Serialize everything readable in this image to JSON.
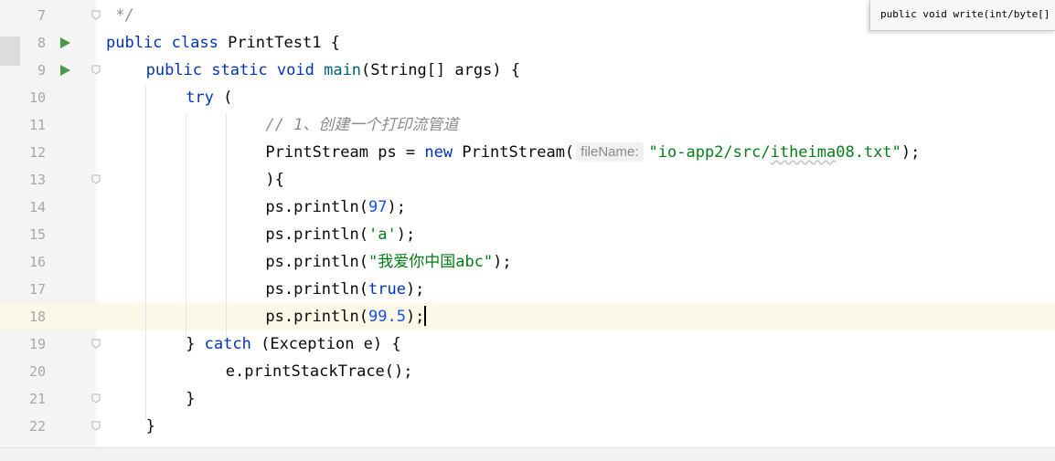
{
  "editor": {
    "lines": [
      {
        "num": "7",
        "indent": 0,
        "run_icon": false,
        "fold_icon": true,
        "current": false,
        "tokens": [
          {
            "t": " */",
            "c": "cmt"
          }
        ]
      },
      {
        "num": "8",
        "indent": 0,
        "run_icon": true,
        "fold_icon": false,
        "current": false,
        "tokens": [
          {
            "t": "public ",
            "c": "kw"
          },
          {
            "t": "class ",
            "c": "kw"
          },
          {
            "t": "PrintTest1 {",
            "c": ""
          }
        ]
      },
      {
        "num": "9",
        "indent": 1,
        "run_icon": true,
        "fold_icon": true,
        "current": false,
        "tokens": [
          {
            "t": "public ",
            "c": "kw"
          },
          {
            "t": "static ",
            "c": "kw"
          },
          {
            "t": "void ",
            "c": "kw"
          },
          {
            "t": "main",
            "c": "fn"
          },
          {
            "t": "(String[] args) {",
            "c": ""
          }
        ]
      },
      {
        "num": "10",
        "indent": 2,
        "run_icon": false,
        "fold_icon": false,
        "current": false,
        "tokens": [
          {
            "t": "try ",
            "c": "kw"
          },
          {
            "t": "(",
            "c": ""
          }
        ]
      },
      {
        "num": "11",
        "indent": 4,
        "run_icon": false,
        "fold_icon": false,
        "current": false,
        "tokens": [
          {
            "t": "// 1、创建一个打印流管道",
            "c": "cmt"
          }
        ]
      },
      {
        "num": "12",
        "indent": 4,
        "run_icon": false,
        "fold_icon": false,
        "current": false,
        "tokens": [
          {
            "t": "PrintStream ps = ",
            "c": ""
          },
          {
            "t": "new ",
            "c": "kw"
          },
          {
            "t": "PrintStream(",
            "c": ""
          },
          {
            "t": "fileName:",
            "c": "hint"
          },
          {
            "t": "\"io-app2/src/",
            "c": "str"
          },
          {
            "t": "itheima",
            "c": "str squiggle"
          },
          {
            "t": "08.txt\"",
            "c": "str"
          },
          {
            "t": ");",
            "c": ""
          }
        ]
      },
      {
        "num": "13",
        "indent": 4,
        "run_icon": false,
        "fold_icon": true,
        "current": false,
        "tokens": [
          {
            "t": "){",
            "c": ""
          }
        ]
      },
      {
        "num": "14",
        "indent": 4,
        "run_icon": false,
        "fold_icon": false,
        "current": false,
        "tokens": [
          {
            "t": "ps.println(",
            "c": ""
          },
          {
            "t": "97",
            "c": "num"
          },
          {
            "t": ");",
            "c": ""
          }
        ]
      },
      {
        "num": "15",
        "indent": 4,
        "run_icon": false,
        "fold_icon": false,
        "current": false,
        "tokens": [
          {
            "t": "ps.println(",
            "c": ""
          },
          {
            "t": "'a'",
            "c": "str"
          },
          {
            "t": ");",
            "c": ""
          }
        ]
      },
      {
        "num": "16",
        "indent": 4,
        "run_icon": false,
        "fold_icon": false,
        "current": false,
        "tokens": [
          {
            "t": "ps.println(",
            "c": ""
          },
          {
            "t": "\"我爱你中国abc\"",
            "c": "str"
          },
          {
            "t": ");",
            "c": ""
          }
        ]
      },
      {
        "num": "17",
        "indent": 4,
        "run_icon": false,
        "fold_icon": false,
        "current": false,
        "tokens": [
          {
            "t": "ps.println(",
            "c": ""
          },
          {
            "t": "true",
            "c": "kw"
          },
          {
            "t": ");",
            "c": ""
          }
        ]
      },
      {
        "num": "18",
        "indent": 4,
        "run_icon": false,
        "fold_icon": false,
        "current": true,
        "tokens": [
          {
            "t": "ps.println(",
            "c": ""
          },
          {
            "t": "99.5",
            "c": "num"
          },
          {
            "t": ");",
            "c": ""
          },
          {
            "t": "",
            "c": "caret"
          }
        ]
      },
      {
        "num": "19",
        "indent": 2,
        "run_icon": false,
        "fold_icon": true,
        "current": false,
        "tokens": [
          {
            "t": "} ",
            "c": ""
          },
          {
            "t": "catch ",
            "c": "kw"
          },
          {
            "t": "(Exception e) {",
            "c": ""
          }
        ]
      },
      {
        "num": "20",
        "indent": 3,
        "run_icon": false,
        "fold_icon": false,
        "current": false,
        "tokens": [
          {
            "t": "e.printStackTrace();",
            "c": ""
          }
        ]
      },
      {
        "num": "21",
        "indent": 2,
        "run_icon": false,
        "fold_icon": true,
        "current": false,
        "tokens": [
          {
            "t": "}",
            "c": ""
          }
        ]
      },
      {
        "num": "22",
        "indent": 1,
        "run_icon": false,
        "fold_icon": true,
        "current": false,
        "tokens": [
          {
            "t": "}",
            "c": ""
          }
        ]
      }
    ]
  },
  "popup": {
    "text": "public void write(int/byte[]"
  },
  "colors": {
    "keyword": "#0033b3",
    "comment": "#8c8c8c",
    "string": "#067d17",
    "number": "#1750eb",
    "method": "#00627a",
    "current_line": "#fcf8e8",
    "run_icon": "#4a9a4a"
  }
}
